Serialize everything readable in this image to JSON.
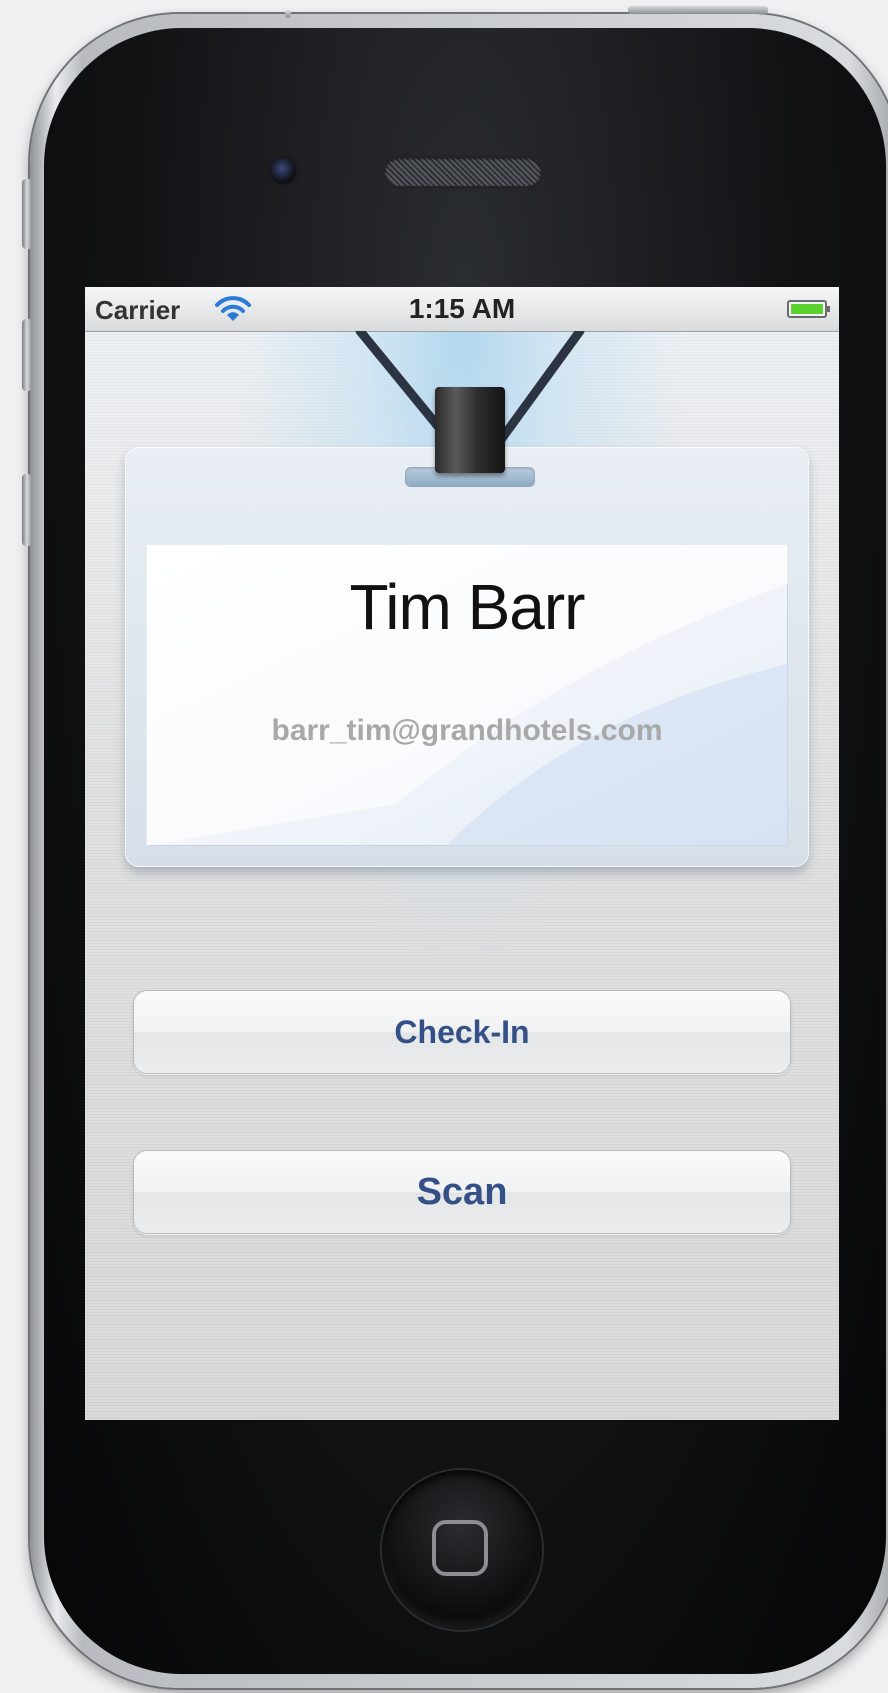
{
  "status_bar": {
    "carrier": "Carrier",
    "time": "1:15 AM",
    "wifi_icon": "wifi-icon",
    "battery_icon": "battery-icon",
    "battery_color": "#5bd12e"
  },
  "badge": {
    "name": "Tim Barr",
    "email": "barr_tim@grandhotels.com"
  },
  "actions": {
    "checkin_label": "Check-In",
    "scan_label": "Scan"
  },
  "colors": {
    "button_text": "#355086",
    "email_text": "#a8a8a8"
  }
}
